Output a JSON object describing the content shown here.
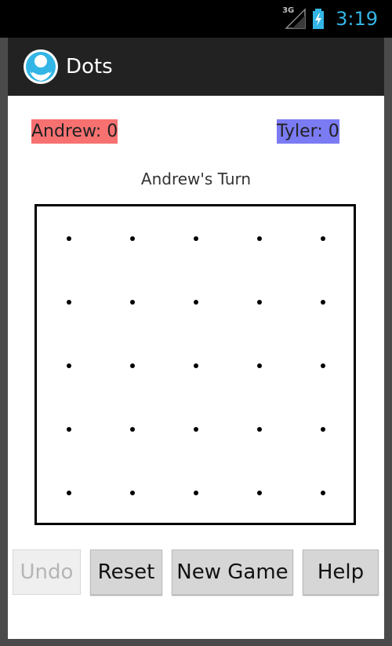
{
  "status_bar": {
    "network": "3G",
    "time": "3:19"
  },
  "action_bar": {
    "title": "Dots",
    "icon": "app-logo-icon"
  },
  "scores": {
    "player1": "Andrew: 0",
    "player2": "Tyler: 0",
    "player1_color": "#f87171",
    "player2_color": "#7b7bf4"
  },
  "turn_label": "Andrew's Turn",
  "board": {
    "rows": 5,
    "cols": 5
  },
  "buttons": {
    "undo": "Undo",
    "reset": "Reset",
    "new_game": "New Game",
    "help": "Help"
  },
  "colors": {
    "accent": "#33b5e5",
    "action_bar": "#222222"
  }
}
